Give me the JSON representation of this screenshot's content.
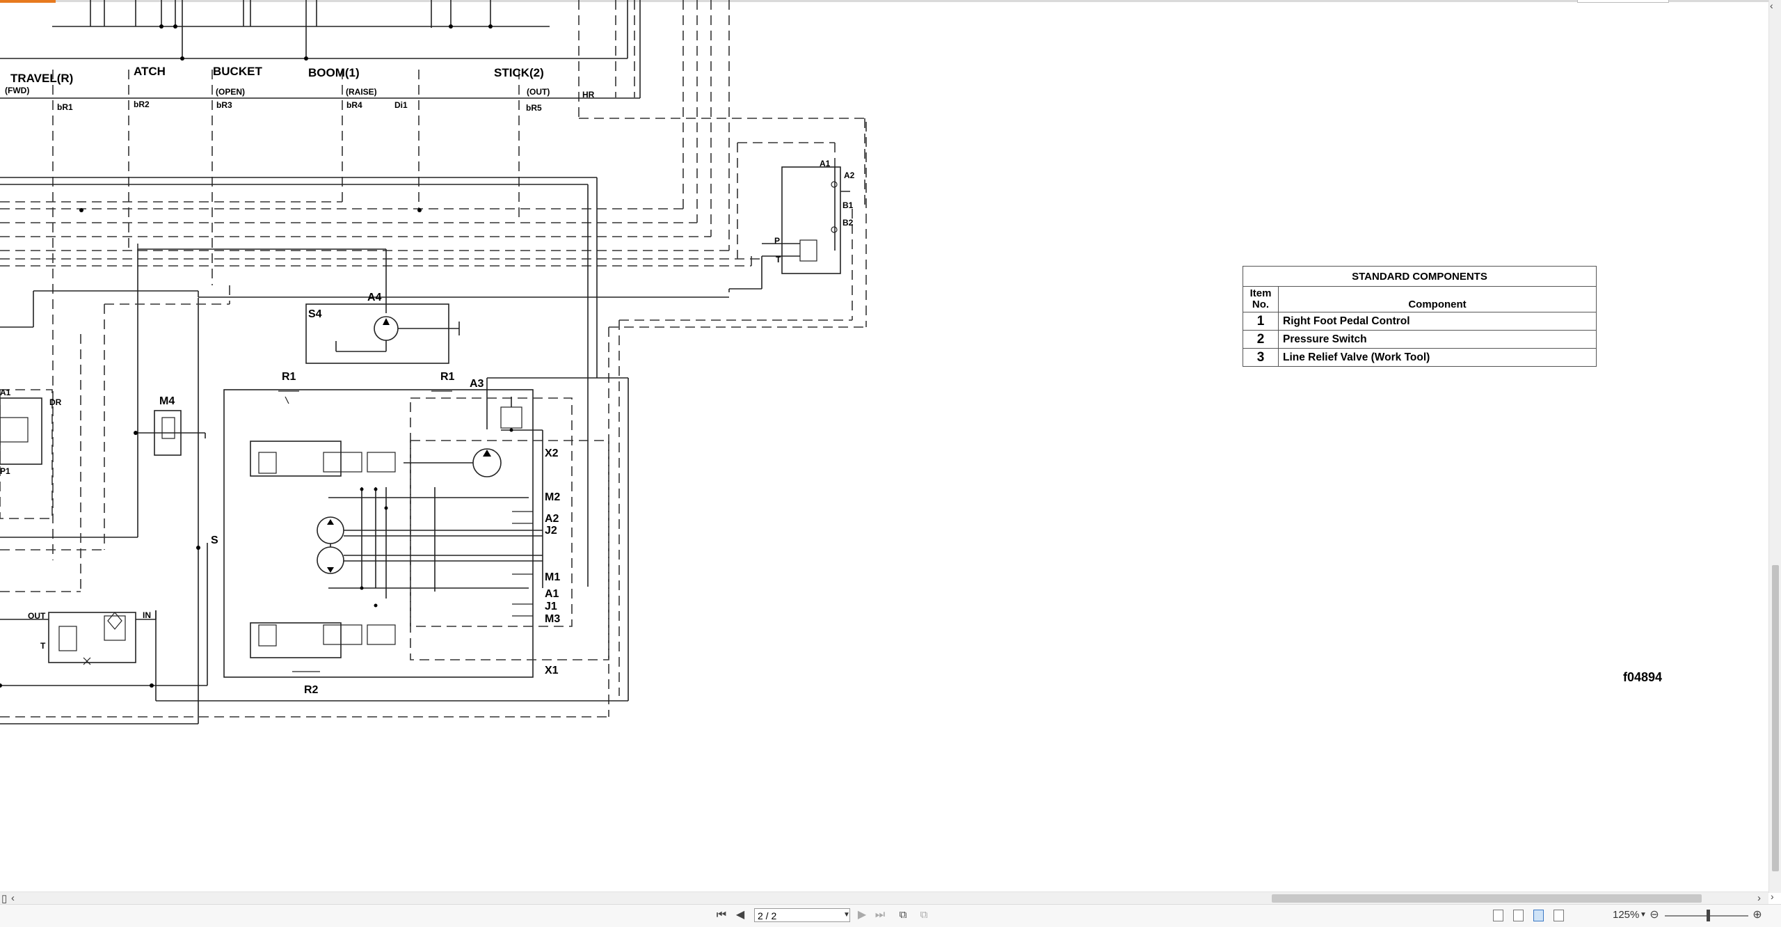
{
  "schematic_labels": {
    "travel": "TRAVEL(R)",
    "travel_sub": "(FWD)",
    "atch": "ATCH",
    "bucket": "BUCKET",
    "bucket_sub": "(OPEN)",
    "boom": "BOOM(1)",
    "boom_sub": "(RAISE)",
    "stick": "STICK(2)",
    "stick_sub": "(OUT)",
    "hr": "HR",
    "br1": "bR1",
    "br2": "bR2",
    "br3": "bR3",
    "br4": "bR4",
    "di1": "Di1",
    "br5": "bR5",
    "a1_top": "A1",
    "a2_top": "A2",
    "b1": "B1",
    "b2": "B2",
    "p": "P",
    "t_valve": "T",
    "s4": "S4",
    "a4": "A4",
    "r1_left": "R1",
    "r1_right": "R1",
    "a3": "A3",
    "a1_left": "A1",
    "dr": "DR",
    "p1": "P1",
    "m4": "M4",
    "x2": "X2",
    "m2": "M2",
    "a2_mid": "A2",
    "j2": "J2",
    "s": "S",
    "m1": "M1",
    "a1_mid": "A1",
    "j1": "J1",
    "m3": "M3",
    "out": "OUT",
    "in": "IN",
    "t_filter": "T",
    "x1": "X1",
    "r2": "R2"
  },
  "components_table": {
    "title": "STANDARD COMPONENTS",
    "header_item": "Item No.",
    "header_component": "Component",
    "rows": [
      {
        "num": "1",
        "name": "Right Foot Pedal Control"
      },
      {
        "num": "2",
        "name": "Pressure Switch"
      },
      {
        "num": "3",
        "name": "Line Relief Valve (Work Tool)"
      }
    ]
  },
  "figure_id": "f04894",
  "toolbar": {
    "first_page": "⏮",
    "prev_page": "◀",
    "page_indicator": "2 / 2",
    "next_page": "▶",
    "last_page": "⏭",
    "zoom": "125%",
    "zoom_out": "⊖",
    "zoom_in": "⊕"
  },
  "scrollbar": {
    "left_arrow": "‹",
    "right_arrow": "›",
    "up_arrow": "‹",
    "down_arrow": "›"
  },
  "icons": [
    "first-page-icon",
    "prev-page-icon",
    "next-page-icon",
    "last-page-icon",
    "fit-page-icon",
    "zoom-out-icon",
    "zoom-in-icon"
  ]
}
